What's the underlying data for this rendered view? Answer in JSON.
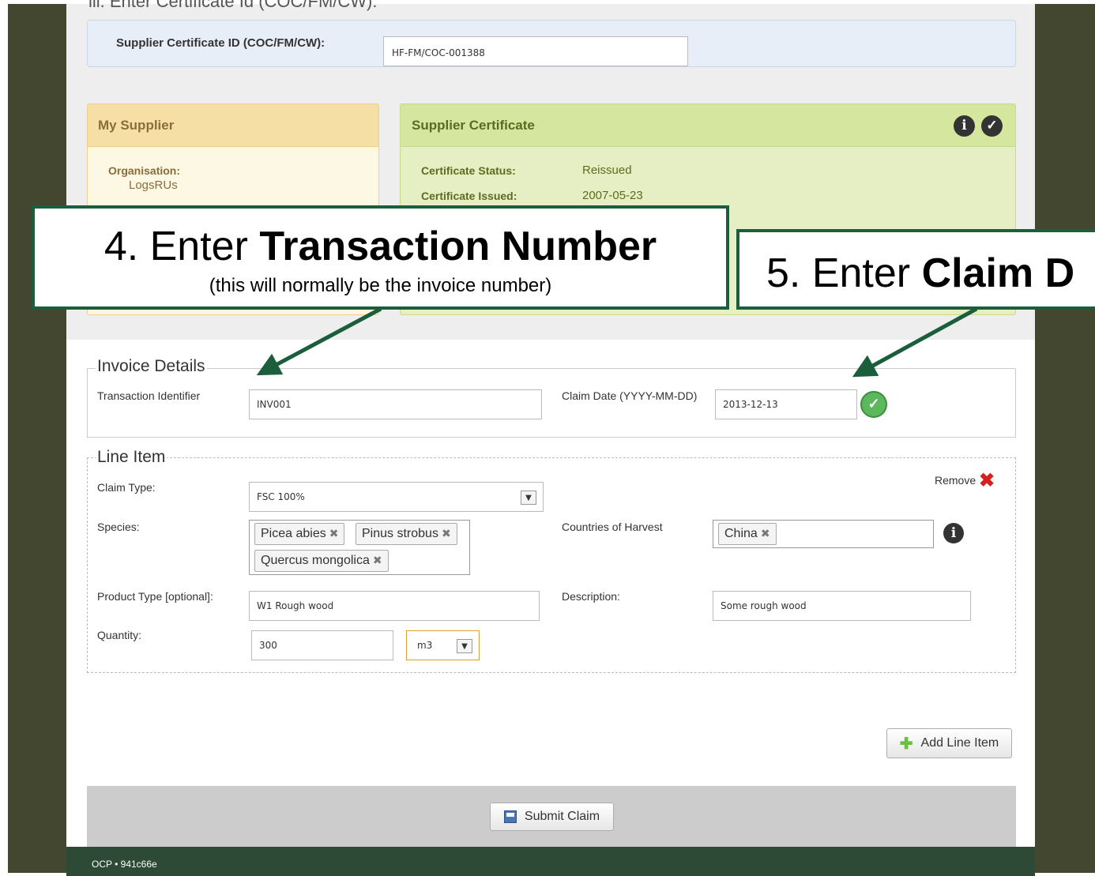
{
  "step_heading": "iii. Enter Certificate Id (COC/FM/CW):",
  "certificate": {
    "label": "Supplier Certificate ID (COC/FM/CW):",
    "value": "HF-FM/COC-001388"
  },
  "my_supplier": {
    "title": "My Supplier",
    "org_label": "Organisation:",
    "org_value": "LogsRUs"
  },
  "supplier_certificate": {
    "title": "Supplier Certificate",
    "status_label": "Certificate Status:",
    "status_value": "Reissued",
    "issued_label": "Certificate Issued:",
    "issued_value": "2007-05-23"
  },
  "callouts": {
    "step4_prefix": "4. Enter ",
    "step4_bold": "Transaction Number",
    "step4_note": "(this will normally be the invoice number)",
    "step5_prefix": "5. Enter ",
    "step5_bold": "Claim D"
  },
  "invoice": {
    "legend": "Invoice Details",
    "transaction_label": "Transaction Identifier",
    "transaction_value": "INV001",
    "claim_date_label": "Claim Date (YYYY-MM-DD)",
    "claim_date_value": "2013-12-13"
  },
  "line_item": {
    "legend": "Line Item",
    "remove_label": "Remove",
    "claim_type_label": "Claim Type:",
    "claim_type_value": "FSC 100%",
    "species_label": "Species:",
    "species": [
      "Picea abies",
      "Pinus strobus",
      "Quercus mongolica"
    ],
    "countries_label": "Countries of Harvest",
    "countries": [
      "China"
    ],
    "product_type_label": "Product Type [optional]:",
    "product_type_value": "W1 Rough wood",
    "description_label": "Description:",
    "description_value": "Some rough wood",
    "quantity_label": "Quantity:",
    "quantity_value": "300",
    "unit_value": "m3"
  },
  "buttons": {
    "add_line_item": "Add Line Item",
    "submit_claim": "Submit Claim"
  },
  "footer": "OCP • 941c66e",
  "colors": {
    "frame": "#444730",
    "callout_border": "#1b5e3b",
    "footer_bg": "#2d4a36",
    "supplier_panel": "#fcf8e3",
    "certificate_panel": "#e6efc4"
  }
}
